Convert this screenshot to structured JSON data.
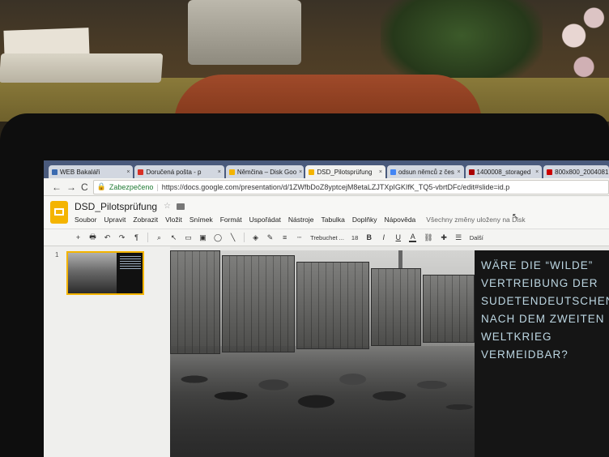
{
  "browser": {
    "tabs": [
      {
        "label": "WEB Bakaláři",
        "favicon_color": "#3a6ab0",
        "active": false
      },
      {
        "label": "Doručená pošta - p",
        "favicon_color": "#d93025",
        "active": false
      },
      {
        "label": "Němčina – Disk Goo",
        "favicon_color": "#f4b400",
        "active": false
      },
      {
        "label": "DSD_Pilotsprüfung",
        "favicon_color": "#f4b400",
        "active": true
      },
      {
        "label": "odsun němců z čes",
        "favicon_color": "#4285f4",
        "active": false
      },
      {
        "label": "1400008_storaged",
        "favicon_color": "#a00",
        "active": false
      },
      {
        "label": "800x800_20040817",
        "favicon_color": "#c00",
        "active": false
      }
    ],
    "close_glyph": "×",
    "back_glyph": "←",
    "forward_glyph": "→",
    "reload_glyph": "C",
    "security_label": "Zabezpečeno",
    "url": "https://docs.google.com/presentation/d/1ZWfbDoZ8yptcejM8etaLZJTXpIGKIfK_TQ5-vbrtDFc/edit#slide=id.p"
  },
  "slides_app": {
    "document_title": "DSD_Pilotsprüfung",
    "star_glyph": "☆",
    "menu": [
      "Soubor",
      "Upravit",
      "Zobrazit",
      "Vložit",
      "Snímek",
      "Formát",
      "Uspořádat",
      "Nástroje",
      "Tabulka",
      "Doplňky",
      "Nápověda"
    ],
    "save_status": "Všechny změny uloženy na Disk",
    "toolbar": {
      "add": "+",
      "font": "Trebuchet ...",
      "size": "18",
      "bold": "B",
      "italic": "I",
      "underline": "U",
      "text_color": "A",
      "more": "Další"
    }
  },
  "filmstrip": {
    "slides": [
      {
        "number": "1"
      }
    ]
  },
  "slide": {
    "heading": "WÄRE DIE “WILDE”\nVERTREIBUNG DER\nSUDETENDEUTSCHEN\nNACH DEM ZWEITEN\nWELTKRIEG\nVERMEIDBAR?"
  },
  "colors": {
    "accent": "#f4b400",
    "slide_text": "#bcd6e2",
    "tab_strip": "#4a5a7c"
  }
}
